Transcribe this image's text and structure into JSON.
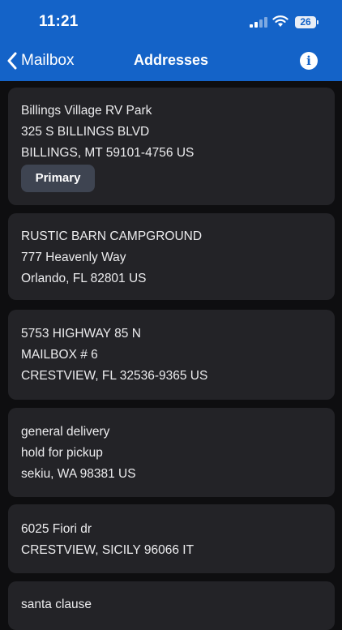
{
  "status_bar": {
    "time": "11:21",
    "battery": "26"
  },
  "nav": {
    "back_label": "Mailbox",
    "title": "Addresses",
    "info_icon": "i"
  },
  "colors": {
    "header": "#1463c8",
    "background": "#0e0e10",
    "card": "#232327",
    "badge": "#3e4451"
  },
  "addresses": [
    {
      "lines": [
        "Billings Village RV Park",
        "325 S BILLINGS BLVD",
        "BILLINGS, MT 59101-4756 US"
      ],
      "badge": "Primary"
    },
    {
      "lines": [
        "RUSTIC BARN CAMPGROUND",
        "777 Heavenly Way",
        "Orlando, FL 82801 US"
      ]
    },
    {
      "lines": [
        "5753 HIGHWAY 85 N",
        "MAILBOX # 6",
        "CRESTVIEW, FL 32536-9365 US"
      ]
    },
    {
      "lines": [
        "general delivery",
        "hold for pickup",
        "sekiu, WA 98381 US"
      ]
    },
    {
      "lines": [
        "6025 Fiori dr",
        "CRESTVIEW, SICILY 96066 IT"
      ]
    },
    {
      "lines": [
        "santa clause"
      ]
    }
  ]
}
